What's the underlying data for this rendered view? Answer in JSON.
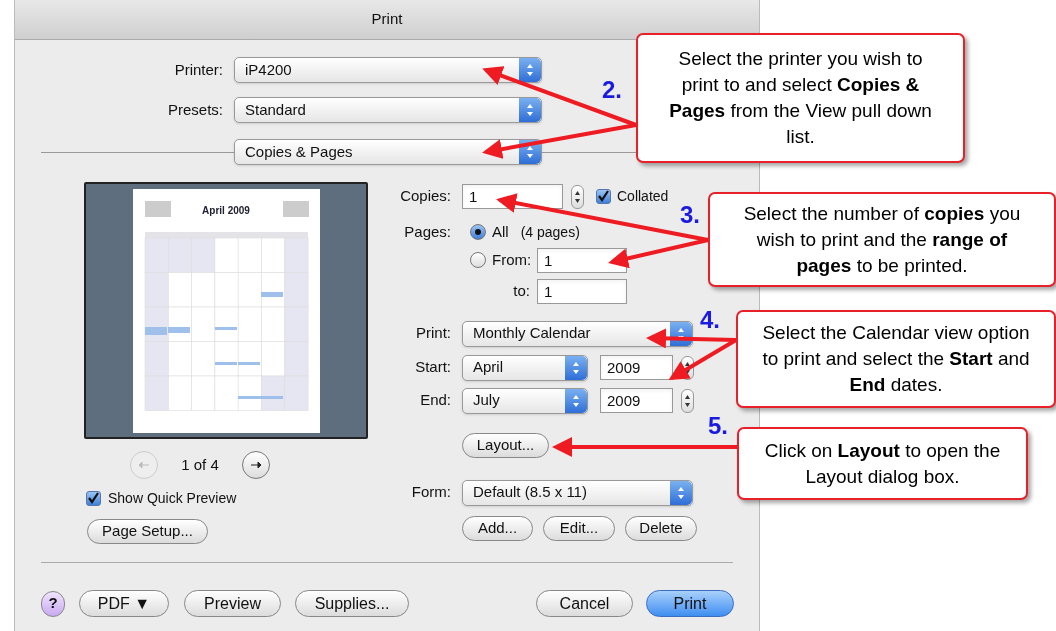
{
  "window": {
    "title": "Print"
  },
  "printer": {
    "label": "Printer:",
    "value": "iP4200"
  },
  "presets": {
    "label": "Presets:",
    "value": "Standard"
  },
  "panel_menu": {
    "value": "Copies & Pages"
  },
  "preview": {
    "title": "April 2009",
    "page": "1 of 4",
    "back_enabled": false,
    "forward_enabled": true,
    "show_quick_preview": {
      "label": "Show Quick Preview",
      "checked": true
    },
    "page_setup": "Page Setup..."
  },
  "copies": {
    "label": "Copies:",
    "value": "1",
    "collated": {
      "label": "Collated",
      "checked": true
    }
  },
  "pages": {
    "label": "Pages:",
    "options": [
      {
        "label": "All",
        "note": "(4 pages)",
        "selected": true
      },
      {
        "label": "From:",
        "value": "1",
        "selected": false
      }
    ],
    "to": {
      "label": "to:",
      "value": "1"
    }
  },
  "calendar": {
    "print": {
      "label": "Print:",
      "value": "Monthly Calendar"
    },
    "start": {
      "label": "Start:",
      "month": "April",
      "year": "2009"
    },
    "end": {
      "label": "End:",
      "month": "July",
      "year": "2009"
    },
    "layout": "Layout..."
  },
  "form": {
    "label": "Form:",
    "value": "Default (8.5 x 11)",
    "buttons": [
      "Add...",
      "Edit...",
      "Delete"
    ]
  },
  "help": "?",
  "bottom_buttons": [
    {
      "label": "PDF ▼",
      "kind": "normal"
    },
    {
      "label": "Preview",
      "kind": "normal"
    },
    {
      "label": "Supplies...",
      "kind": "normal"
    },
    {
      "label": "Cancel",
      "kind": "normal"
    },
    {
      "label": "Print",
      "kind": "default"
    }
  ],
  "callouts": [
    {
      "number": "2.",
      "text": "Select the printer you wish to print to and select **Copies & Pages** from the View pull down list."
    },
    {
      "number": "3.",
      "text": "Select the number of **copies** you wish to print and the **range of pages** to be printed."
    },
    {
      "number": "4.",
      "text": "Select the Calendar view option to print and select the **Start** and **End** dates."
    },
    {
      "number": "5.",
      "text": "Click on **Layout** to open the Layout dialog box."
    }
  ]
}
